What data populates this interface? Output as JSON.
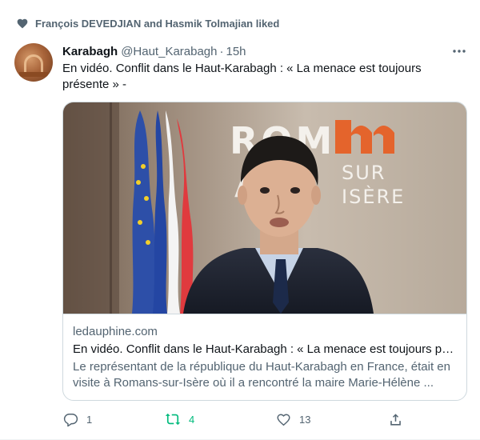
{
  "social_context": {
    "text": "François DEVEDJIAN and Hasmik Tolmajian liked",
    "icon": "heart-icon"
  },
  "tweet": {
    "author_name": "Karabagh",
    "handle": "@Haut_Karabagh",
    "separator": "·",
    "time": "15h",
    "more_icon": "more-horizontal-icon",
    "text": "En vidéo. Conflit dans le Haut-Karabagh : « La menace est toujours présente » -"
  },
  "card": {
    "image_text": {
      "sign_top": "ROM",
      "sign_side_1": "SUR",
      "sign_side_2": "ISÈRE"
    },
    "domain": "ledauphine.com",
    "title": "En vidéo. Conflit dans le Haut-Karabagh : « La menace est toujours présente »",
    "description": "Le représentant de la république du Haut-Karabagh en France, était en visite à Romans-sur-Isère où il a rencontré la maire Marie-Hélène ..."
  },
  "actions": {
    "reply": {
      "icon": "reply-icon",
      "count": "1"
    },
    "retweet": {
      "icon": "retweet-icon",
      "count": "4"
    },
    "like": {
      "icon": "heart-outline-icon",
      "count": "13"
    },
    "share": {
      "icon": "share-icon"
    }
  },
  "colors": {
    "retweet_green": "#00ba7c",
    "secondary_text": "#536471",
    "border": "#cfd9de",
    "logo_orange": "#e4642c"
  }
}
